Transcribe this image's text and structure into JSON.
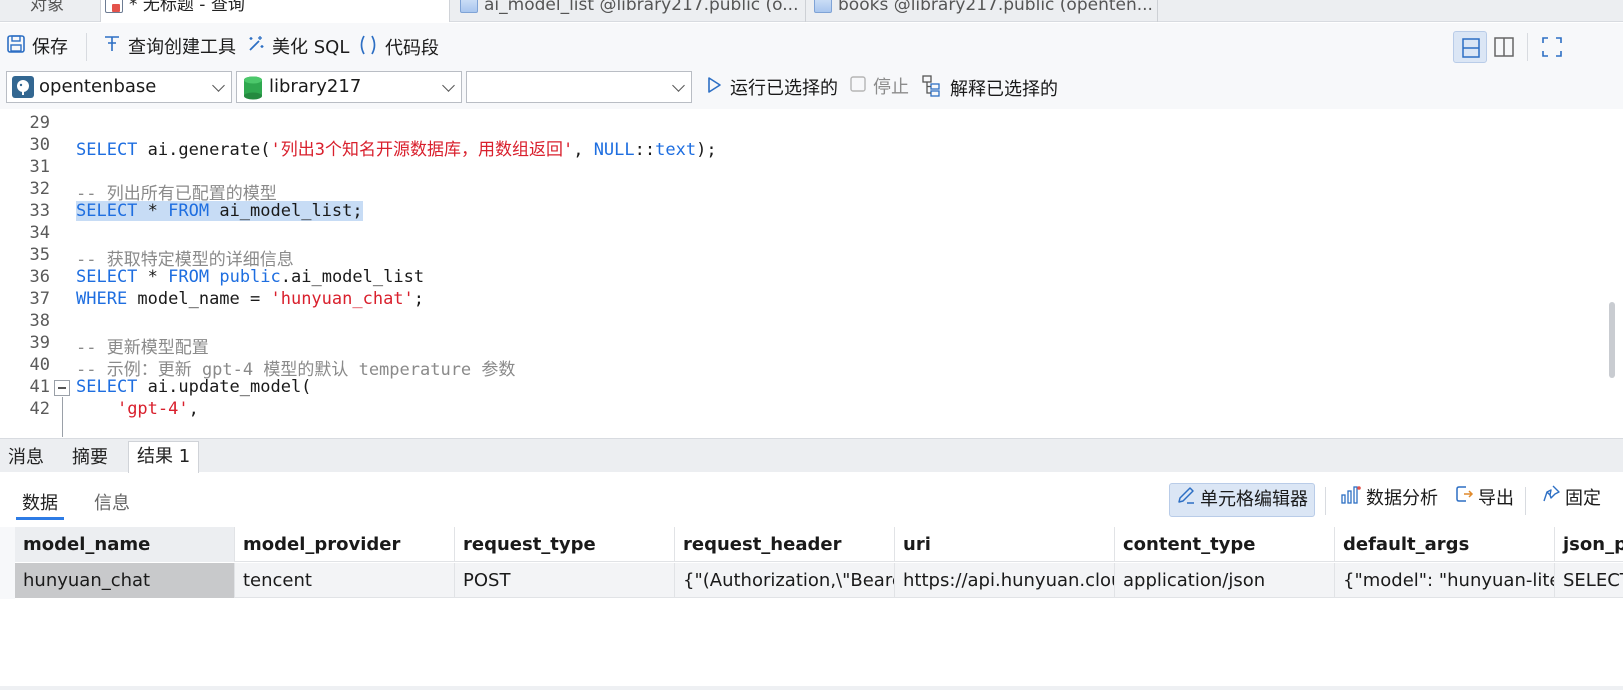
{
  "tabs": [
    {
      "label": "对象",
      "icon": "none"
    },
    {
      "label": "* 无标题 - 查询",
      "icon": "query-icon"
    },
    {
      "label": "ai_model_list @library217.public (o...",
      "icon": "table-icon"
    },
    {
      "label": "books @library217.public (openten...",
      "icon": "table-icon"
    }
  ],
  "toolbar": {
    "save": "保存",
    "query_builder": "查询创建工具",
    "beautify": "美化 SQL",
    "snippet": "代码段"
  },
  "connection": {
    "server": "opentenbase",
    "database": "library217",
    "schema": "",
    "run_selected": "运行已选择的",
    "stop": "停止",
    "explain_selected": "解释已选择的"
  },
  "editor": {
    "lines": [
      {
        "num": "29",
        "text": ""
      },
      {
        "num": "30",
        "text": "SELECT ai.generate('列出3个知名开源数据库，用数组返回', NULL::text);"
      },
      {
        "num": "31",
        "text": ""
      },
      {
        "num": "32",
        "text": "-- 列出所有已配置的模型"
      },
      {
        "num": "33",
        "text": "SELECT * FROM ai_model_list;"
      },
      {
        "num": "34",
        "text": ""
      },
      {
        "num": "35",
        "text": "-- 获取特定模型的详细信息"
      },
      {
        "num": "36",
        "text": "SELECT * FROM public.ai_model_list"
      },
      {
        "num": "37",
        "text": "WHERE model_name = 'hunyuan_chat';"
      },
      {
        "num": "38",
        "text": ""
      },
      {
        "num": "39",
        "text": "-- 更新模型配置"
      },
      {
        "num": "40",
        "text": "-- 示例：更新 gpt-4 模型的默认 temperature 参数"
      },
      {
        "num": "41",
        "text": "SELECT ai.update_model("
      },
      {
        "num": "42",
        "text": "    'gpt-4',"
      }
    ],
    "tokens": {
      "l30": [
        "SELECT",
        " ai.generate(",
        "'列出3个知名开源数据库，用数组返回'",
        ", ",
        "NULL",
        "::",
        "text",
        ");"
      ],
      "l32": "-- 列出所有已配置的模型",
      "l33": [
        "SELECT",
        " * ",
        "FROM",
        " ai_model_list;"
      ],
      "l35": "-- 获取特定模型的详细信息",
      "l36": [
        "SELECT",
        " * ",
        "FROM",
        " ",
        "public",
        ".ai_model_list"
      ],
      "l37": [
        "WHERE",
        " model_name = ",
        "'hunyuan_chat'",
        ";"
      ],
      "l39": "-- 更新模型配置",
      "l40": "-- 示例：更新 gpt-4 模型的默认 temperature 参数",
      "l41": [
        "SELECT",
        " ai.update_model("
      ],
      "l42": [
        "    ",
        "'gpt-4'",
        ","
      ]
    }
  },
  "result_tabs": [
    "消息",
    "摘要",
    "结果 1"
  ],
  "sub_tabs": [
    "数据",
    "信息"
  ],
  "result_tools": {
    "cell_editor": "单元格编辑器",
    "data_analysis": "数据分析",
    "export": "导出",
    "pin": "固定"
  },
  "grid": {
    "columns": [
      "model_name",
      "model_provider",
      "request_type",
      "request_header",
      "uri",
      "content_type",
      "default_args",
      "json_p"
    ],
    "rows": [
      [
        "hunyuan_chat",
        "tencent",
        "POST",
        "{\"(Authorization,\\\"Beare",
        "https://api.hunyuan.clou",
        "application/json",
        "{\"model\": \"hunyuan-lite",
        "SELECT"
      ]
    ]
  },
  "colors": {
    "keyword": "#1e6ee0",
    "string": "#d9202d",
    "comment": "#8a8a8a",
    "selection": "#c7dcf5",
    "accent": "#2d7be5"
  }
}
